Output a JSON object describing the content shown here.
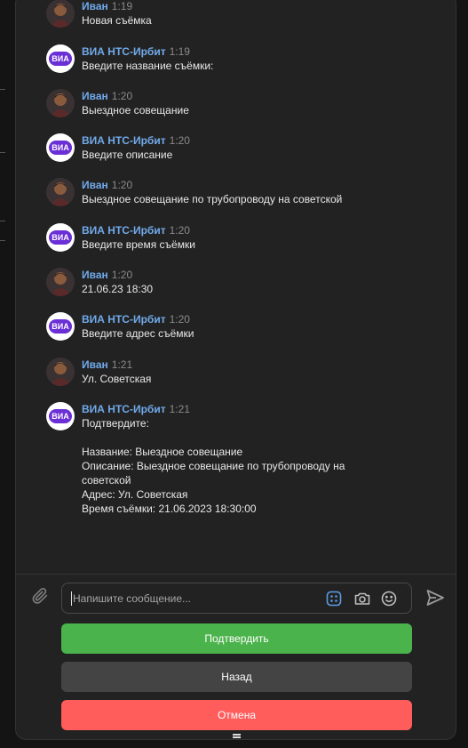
{
  "composer": {
    "placeholder": "Напишите сообщение..."
  },
  "keyboard": {
    "confirm": "Подтвердить",
    "back": "Назад",
    "cancel": "Отмена"
  },
  "messages": [
    {
      "author": "Иван",
      "time": "1:19",
      "text": "Новая съёмка"
    },
    {
      "author": "ВИА НТС-Ирбит",
      "time": "1:19",
      "text": "Введите название съёмки:"
    },
    {
      "author": "Иван",
      "time": "1:20",
      "text": "Выездное совещание"
    },
    {
      "author": "ВИА НТС-Ирбит",
      "time": "1:20",
      "text": "Введите описание"
    },
    {
      "author": "Иван",
      "time": "1:20",
      "text": "Выездное совещание по трубопроводу на советской"
    },
    {
      "author": "ВИА НТС-Ирбит",
      "time": "1:20",
      "text": "Введите время съёмки"
    },
    {
      "author": "Иван",
      "time": "1:20",
      "text": "21.06.23 18:30"
    },
    {
      "author": "ВИА НТС-Ирбит",
      "time": "1:20",
      "text": "Введите адрес съёмки"
    },
    {
      "author": "Иван",
      "time": "1:21",
      "text": "Ул. Советская"
    },
    {
      "author": "ВИА НТС-Ирбит",
      "time": "1:21",
      "confirm": {
        "prompt": "Подтвердите:",
        "name": "Название: Выездное совещание",
        "description": "Описание: Выездное совещание по трубопроводу на советской",
        "address": "Адрес: Ул. Советская",
        "datetime": "Время съёмки: 21.06.2023 18:30:00"
      }
    }
  ],
  "bot_badge": "ВИА",
  "colors": {
    "author": "#71aaeb",
    "confirm": "#4bb34b",
    "back": "#444444",
    "cancel": "#ff5c5c",
    "bot_badge": "#6b2fd6"
  },
  "icons": [
    "paperclip-icon",
    "apps-icon",
    "camera-icon",
    "emoji-icon",
    "send-icon"
  ]
}
